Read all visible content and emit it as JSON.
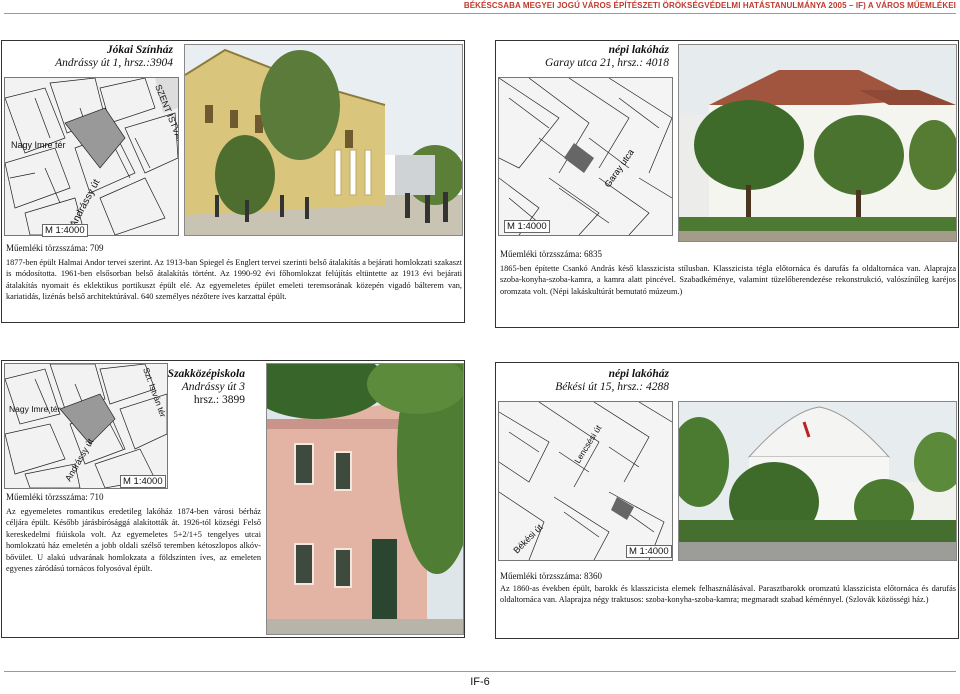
{
  "header": "BÉKÉSCSABA MEGYEI JOGÚ VÁROS ÉPÍTÉSZETI ÖRÖKSÉGVÉDELMI HATÁSTANULMÁNYA 2005 – IF) A VÁROS MŰEMLÉKEI",
  "cards": [
    {
      "title_line1": "Jókai Színház",
      "title_line2": "Andrássy út 1, hrsz.:3904",
      "scale": "M 1:4000",
      "map_labels": [
        "SZENT ISTVÁN TÉR",
        "Nagy Imre tér",
        "Andrássy út"
      ],
      "registry": "Műemléki törzsszáma: 709",
      "description": "1877-ben épült Halmai Andor tervei szerint. Az 1913-ban Spiegel és Englert tervei szerinti belső átalakítás a bejárati homlokzati szakaszt is módosította. 1961-ben elsősorban belső átalakítás történt. Az 1990-92 évi főhomlokzat felújítás eltüntette az 1913 évi bejárati átalakítás nyomait és eklektikus portikuszt épült elé. Az egyemeletes épület emeleti teremsorának közepén vigadó bálterem van, kariatidás, lizénás belső architektúrával. 640 személyes nézőtere íves karzattal épült."
    },
    {
      "title_line1": "népi lakóház",
      "title_line2": "Garay utca 21, hrsz.: 4018",
      "scale": "M 1:4000",
      "map_labels": [
        "Garay utca"
      ],
      "registry": "Műemléki törzsszáma: 6835",
      "description": "1865-ben építette Csankó András késő klasszicista stílusban. Klasszicista tégla előtornáca és darufás fa oldaltornáca van. Alaprajza szoba-konyha-szoba-kamra, a kamra alatt pincével. Szabadkéménye, valamint tüzelőberendezése rekonstrukció, valószínűleg karéjos oromzata volt. (Népi lakáskultúrát bemutató múzeum.)"
    },
    {
      "title_line1": "Szakközépiskola",
      "title_line2": "Andrássy út 3",
      "title_line3": "hrsz.: 3899",
      "scale": "M 1:4000",
      "map_labels": [
        "Szt. István tér",
        "Nagy Imre tér",
        "Andrássy út"
      ],
      "registry": "Műemléki törzsszáma: 710",
      "description": "Az egyemeletes romantikus eredetileg lakóház 1874-ben városi bérház céljára épült. Később járásbírósággá alakították át. 1926-tól községi Felső kereskedelmi fiúiskola volt. Az egyemeletes 5+2/1+5 tengelyes utcai homlokzatú ház emeletén a jobb oldali szélső teremben kétoszlopos alkóv-bővület. U alakú udvarának homlokzata a földszinten íves, az emeleten egyenes záródású tornácos folyosóval épült."
    },
    {
      "title_line1": "népi lakóház",
      "title_line2": "Békési út 15, hrsz.: 4288",
      "scale": "M 1:4000",
      "map_labels": [
        "Lencsési út",
        "Békési út"
      ],
      "registry": "Műemléki törzsszáma: 8360",
      "description": "Az 1860-as években épült, barokk és klasszicista elemek felhasználásával. Parasztbarokk oromzatú klasszicista előtornáca és darufás oldaltornáca van. Alaprajza négy traktusos: szoba-konyha-szoba-kamra; megmaradt szabad kéménnyel. (Szlovák közösségi ház.)"
    }
  ],
  "page_number": "IF-6"
}
